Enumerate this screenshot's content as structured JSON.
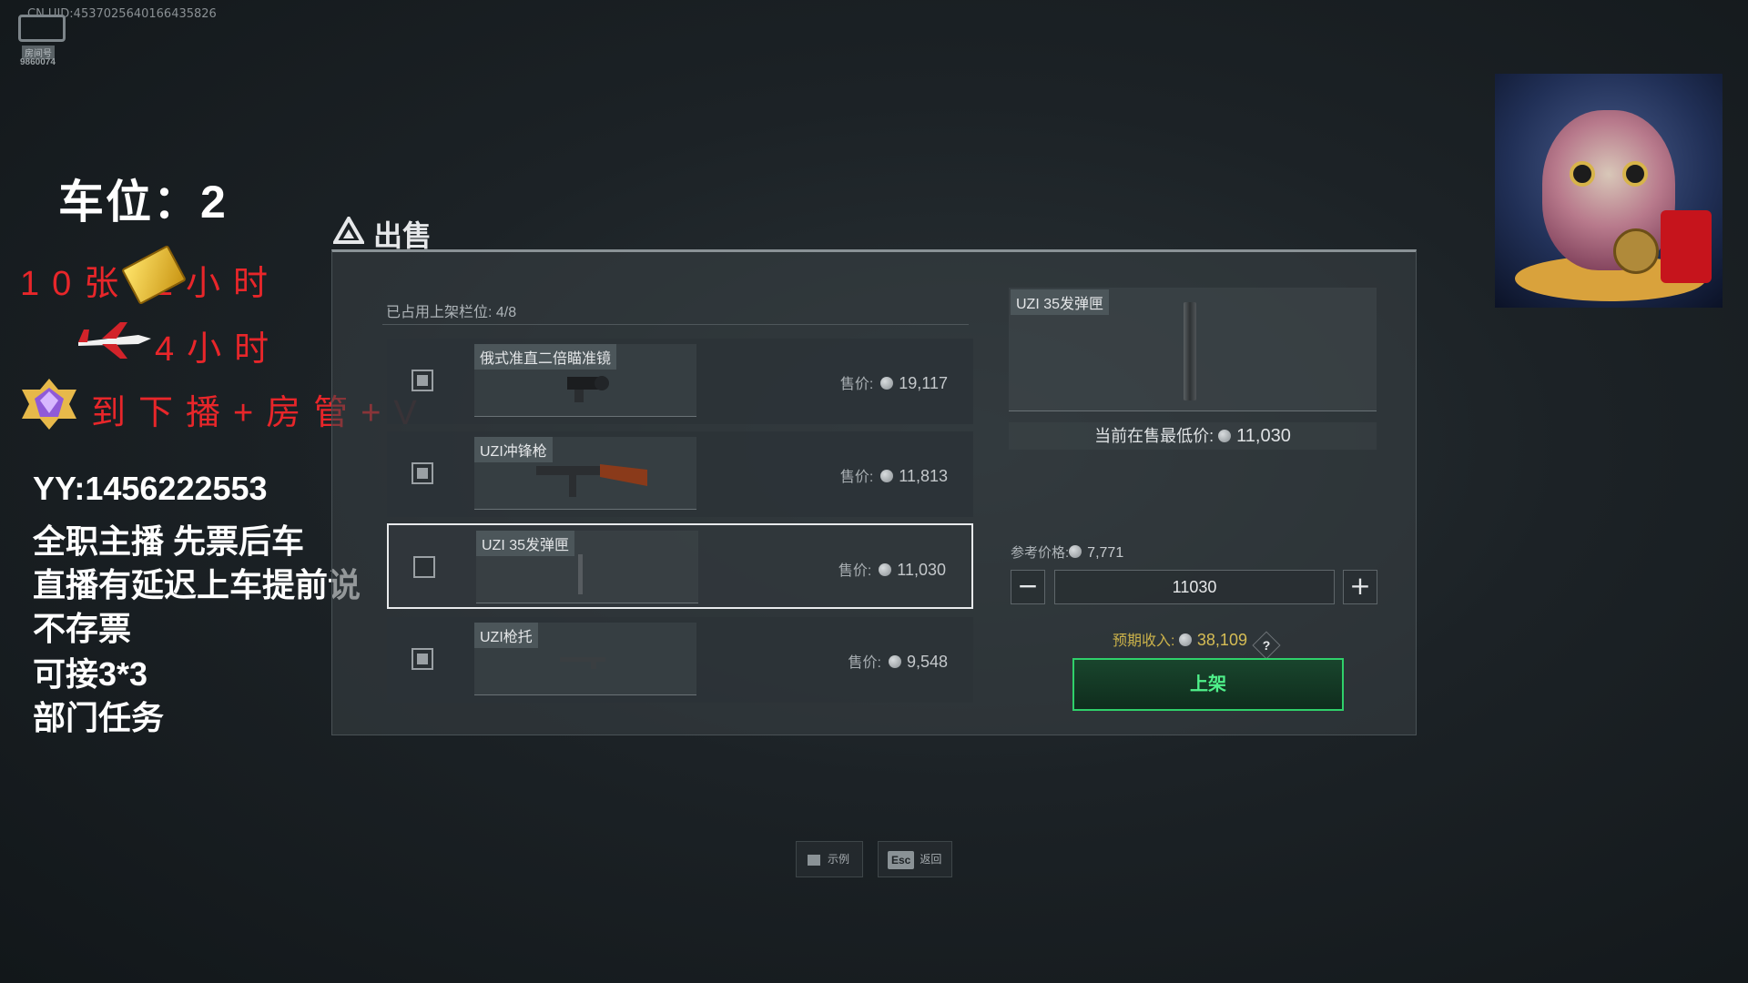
{
  "watermark": "CN UID:4537025640166435826",
  "logo": {
    "room_label": "房间号",
    "room_id": "9860074"
  },
  "overlay": {
    "slot_text": "车位：2",
    "line1": "10张      2小时",
    "line2": "4小时",
    "line3": "到下播+房管+V",
    "yy": "YY:1456222553",
    "notes": [
      "全职主播 先票后车",
      "直播有延迟上车提前说",
      "不存票",
      "可接3*3",
      "部门任务"
    ]
  },
  "sell": {
    "title": "出售",
    "slots_used": "已占用上架栏位: 4/8",
    "price_label": "售价:",
    "items": [
      {
        "name": "俄式准直二倍瞄准镜",
        "price": "19,117",
        "checked": true
      },
      {
        "name": "UZI冲锋枪",
        "price": "11,813",
        "checked": true
      },
      {
        "name": "UZI 35发弹匣",
        "price": "11,030",
        "checked": false
      },
      {
        "name": "UZI枪托",
        "price": "9,548",
        "checked": true
      }
    ],
    "detail": {
      "name": "UZI 35发弹匣",
      "lowest_label": "当前在售最低价:",
      "lowest_value": "11,030",
      "ref_label": "参考价格:",
      "ref_value": "7,771",
      "quantity": "11030",
      "minus": "−",
      "plus": "+",
      "income_label": "预期收入:",
      "income_value": "38,109",
      "help": "?",
      "list_button": "上架"
    }
  },
  "footer": {
    "example": "示例",
    "esc_key": "Esc",
    "back": "返回"
  }
}
